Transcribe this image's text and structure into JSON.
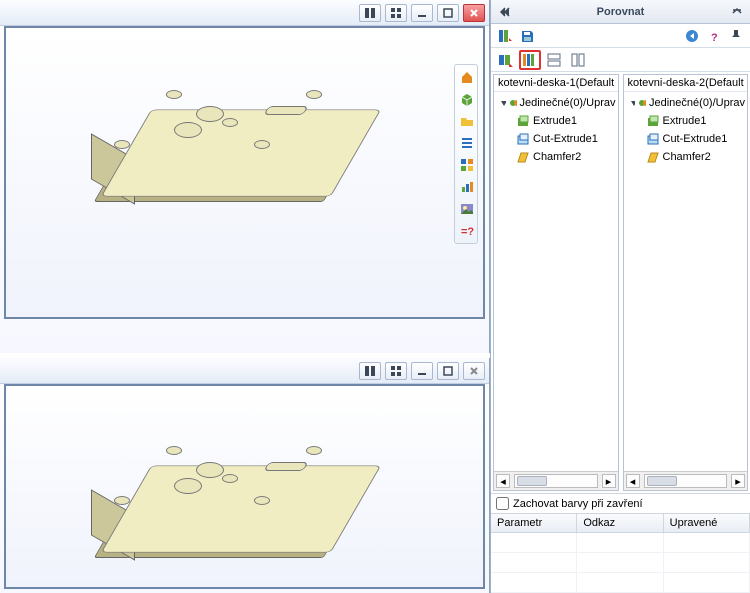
{
  "panel": {
    "title": "Porovnat",
    "back_icon": "chevrons",
    "expand_tip": "expand",
    "close_tip": "close"
  },
  "toolbar1": {
    "analyze_tip": "analyze",
    "save_tip": "save"
  },
  "helpbar": {
    "back_tip": "back",
    "help_tip": "help",
    "pin_tip": "pin"
  },
  "toolbar2": {
    "compare_tip": "compare-options",
    "diff_tip": "show-diff",
    "stack_tip": "stacked-view",
    "sidebyside_tip": "side-by-side"
  },
  "titlebar": {
    "fit_tip": "viewport-split",
    "tile_tip": "viewport-grid",
    "min_tip": "min",
    "max_tip": "max",
    "close_tip": "close"
  },
  "vtoolbar": {
    "items": [
      {
        "name": "home-icon"
      },
      {
        "name": "cube-icon"
      },
      {
        "name": "folder-icon"
      },
      {
        "name": "list-icon"
      },
      {
        "name": "grid-icon"
      },
      {
        "name": "chart-icon"
      },
      {
        "name": "photo-icon"
      },
      {
        "name": "question-icon"
      }
    ]
  },
  "tree_a": {
    "title": "kotevni-deska-1(Default",
    "root": "Jedinečné(0)/Uprav",
    "children": [
      {
        "label": "Extrude1",
        "icon": "extrude"
      },
      {
        "label": "Cut-Extrude1",
        "icon": "cut"
      },
      {
        "label": "Chamfer2",
        "icon": "chamfer"
      }
    ]
  },
  "tree_b": {
    "title": "kotevni-deska-2(Default",
    "root": "Jedinečné(0)/Uprav",
    "children": [
      {
        "label": "Extrude1",
        "icon": "extrude"
      },
      {
        "label": "Cut-Extrude1",
        "icon": "cut"
      },
      {
        "label": "Chamfer2",
        "icon": "chamfer"
      }
    ]
  },
  "check": {
    "label": "Zachovat barvy při zavření",
    "checked": false
  },
  "table": {
    "cols": [
      {
        "label": "Parametr"
      },
      {
        "label": "Odkaz"
      },
      {
        "label": "Upravené"
      }
    ]
  }
}
